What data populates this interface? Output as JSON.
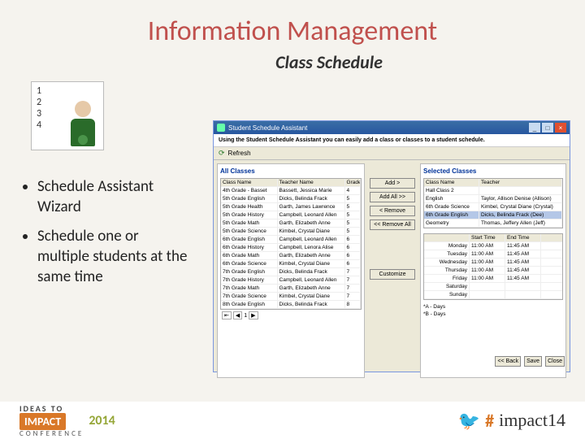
{
  "title": "Information Management",
  "subtitle": "Class Schedule",
  "bullets": [
    "Schedule Assistant Wizard",
    "Schedule one or multiple students at the same time"
  ],
  "window": {
    "title": "Student Schedule Assistant",
    "intro": "Using the Student Schedule Assistant you can easily add a class or classes to a student schedule.",
    "toolbar": {
      "refresh": "Refresh"
    },
    "left": {
      "title": "All Classes",
      "headers": [
        "Class Name",
        "Teacher Name",
        "Grade"
      ],
      "rows": [
        [
          "4th Grade - Basset",
          "Bassett, Jessica Marie",
          "4"
        ],
        [
          "5th Grade English",
          "Dicks, Belinda Frack",
          "5"
        ],
        [
          "5th Grade Health",
          "Garth, James Lawrence",
          "5"
        ],
        [
          "5th Grade History",
          "Campbell, Leonard Allen",
          "5"
        ],
        [
          "5th Grade Math",
          "Garth, Elizabeth Anne",
          "5"
        ],
        [
          "5th Grade Science",
          "Kimbel, Crystal Diane",
          "5"
        ],
        [
          "6th Grade English",
          "Campbell, Leonard Allen",
          "6"
        ],
        [
          "6th Grade History",
          "Campbell, Lenora Alise",
          "6"
        ],
        [
          "6th Grade Math",
          "Garth, Elizabeth Anne",
          "6"
        ],
        [
          "6th Grade Science",
          "Kimbel, Crystal Diane",
          "6"
        ],
        [
          "7th Grade English",
          "Dicks, Belinda Frack",
          "7"
        ],
        [
          "7th Grade History",
          "Campbell, Leonard Allen",
          "7"
        ],
        [
          "7th Grade Math",
          "Garth, Elizabeth Anne",
          "7"
        ],
        [
          "7th Grade Science",
          "Kimbel, Crystal Diane",
          "7"
        ],
        [
          "8th Grade English",
          "Dicks, Belinda Frack",
          "8"
        ]
      ],
      "pager": "1"
    },
    "buttons": {
      "add": "Add >",
      "addAll": "Add All >>",
      "remove": "< Remove",
      "removeAll": "<< Remove All",
      "customize": "Customize"
    },
    "right": {
      "title": "Selected Classes",
      "headers": [
        "Class Name",
        "Teacher"
      ],
      "rows": [
        [
          "Hall Class 2",
          ""
        ],
        [
          "English",
          "Taylor, Allison Denise (Allison)"
        ],
        [
          "6th Grade Science",
          "Kimbel, Crystal Diane (Crystal)"
        ],
        [
          "6th Grade English",
          "Dicks, Belinda Frack (Dee)"
        ],
        [
          "Geometry",
          "Thomas, Jeffery Allen (Jeff)"
        ]
      ],
      "selectedIndex": 3,
      "timeHeaders": [
        "Start Time",
        "End Time"
      ],
      "times": [
        [
          "Monday",
          "11:00 AM",
          "11:45 AM"
        ],
        [
          "Tuesday",
          "11:00 AM",
          "11:45 AM"
        ],
        [
          "Wednesday",
          "11:00 AM",
          "11:45 AM"
        ],
        [
          "Thursday",
          "11:00 AM",
          "11:45 AM"
        ],
        [
          "Friday",
          "11:00 AM",
          "11:45 AM"
        ],
        [
          "Saturday",
          "",
          ""
        ],
        [
          "Sunday",
          "",
          ""
        ]
      ],
      "legend": [
        "*A - Days",
        "*B - Days"
      ]
    },
    "bottom": {
      "back": "<< Back",
      "save": "Save",
      "close": "Close"
    }
  },
  "footer": {
    "ideas": "IDEAS TO",
    "impact": "IMPACT",
    "conference": "CONFERENCE",
    "year": "2014",
    "hash": "#",
    "hashtag": "impact14"
  }
}
